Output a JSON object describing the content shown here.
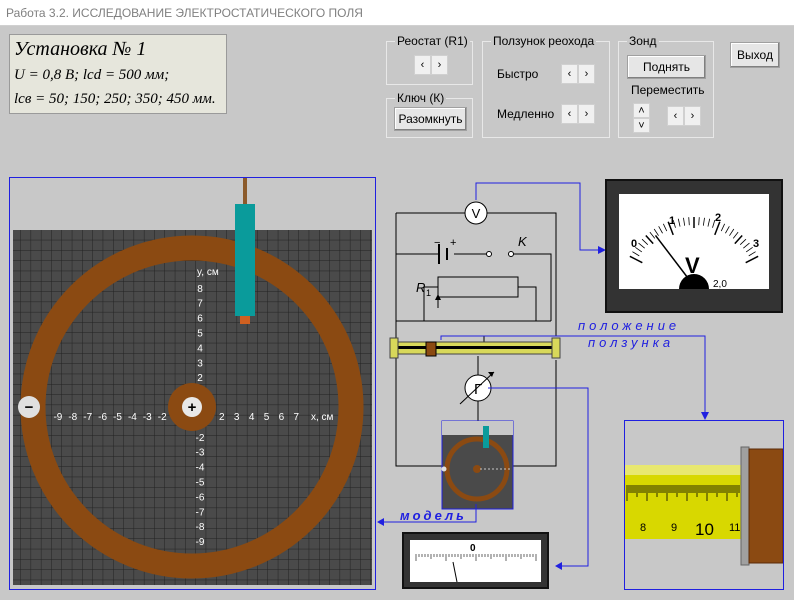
{
  "window": {
    "title": "Работа 3.2. ИССЛЕДОВАНИЕ ЭЛЕКТРОСТАТИЧЕСКОГО ПОЛЯ"
  },
  "setup": {
    "title": "Установка № 1",
    "line2": "U = 0,8 В;   lcd = 500 мм;",
    "line3": "lсв = 50; 150; 250; 350; 450 мм."
  },
  "controls": {
    "rheostat": {
      "label": "Реостат (R1)"
    },
    "key": {
      "label": "Ключ (К)",
      "button": "Разомкнуть"
    },
    "slider": {
      "label": "Ползунок реохода",
      "fast": "Быстро",
      "slow": "Медленно"
    },
    "probe": {
      "label": "Зонд",
      "raise": "Поднять",
      "move": "Переместить"
    },
    "exit": "Выход",
    "arrow_left": "‹",
    "arrow_right": "›",
    "arrow_up": "˄",
    "arrow_down": "˅"
  },
  "plot": {
    "axis_y": "y, см",
    "axis_x": "x, см",
    "y_ticks_pos": [
      "8",
      "7",
      "6",
      "5",
      "4",
      "3",
      "2"
    ],
    "y_ticks_neg": [
      "-2",
      "-3",
      "-4",
      "-5",
      "-6",
      "-7",
      "-8",
      "-9"
    ],
    "x_ticks_neg": [
      "-9",
      "-8",
      "-7",
      "-6",
      "-5",
      "-4",
      "-3",
      "-2"
    ],
    "x_ticks_pos": [
      "2",
      "3",
      "4",
      "5",
      "6",
      "7"
    ],
    "minus_sign": "−",
    "plus_sign": "+"
  },
  "circuit": {
    "voltmeter_symbol": "V",
    "galvanometer_symbol": "Г",
    "key_label": "K",
    "resistor_label": "R",
    "resistor_sub": "1",
    "battery_minus": "−",
    "battery_plus": "+",
    "slider_note_1": "положение",
    "slider_note_2": "ползунка",
    "model_note": "модель"
  },
  "voltmeter": {
    "scale": [
      "0",
      "1",
      "2",
      "3"
    ],
    "symbol": "V",
    "range": "2,0",
    "reading": 0.65,
    "scale_max": 3
  },
  "ruler": {
    "ticks": [
      "8",
      "9",
      "10",
      "11"
    ],
    "major": "10"
  },
  "galvanometer": {
    "zero": "0"
  },
  "colors": {
    "ring": "#8b4a12",
    "grid": "#303030",
    "accent": "#2020e0",
    "probe": "#0a9b9b"
  }
}
